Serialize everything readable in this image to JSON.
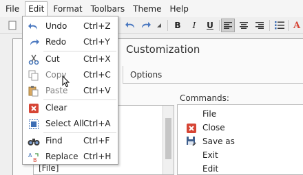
{
  "menubar": {
    "items": [
      {
        "label": "File"
      },
      {
        "label": "Edit"
      },
      {
        "label": "Format"
      },
      {
        "label": "Toolbars"
      },
      {
        "label": "Theme"
      },
      {
        "label": "Help"
      }
    ]
  },
  "toolbar": {
    "bold": "B",
    "italic": "I",
    "underline": "U",
    "font_color": "A"
  },
  "dialog": {
    "title": "Customization",
    "tab_options": "Options",
    "commands_label": "Commands:",
    "tree_item": "[File]",
    "commands": [
      {
        "label": "File",
        "icon": ""
      },
      {
        "label": "Close",
        "icon": "close-red-icon"
      },
      {
        "label": "Save as",
        "icon": "save-as-icon"
      },
      {
        "label": "Exit",
        "icon": ""
      },
      {
        "label": "Edit",
        "icon": ""
      }
    ]
  },
  "edit_menu": {
    "items": [
      {
        "label": "Undo",
        "shortcut": "Ctrl+Z",
        "icon": "undo-icon",
        "enabled": true
      },
      {
        "label": "Redo",
        "shortcut": "Ctrl+Y",
        "icon": "redo-icon",
        "enabled": true
      },
      {
        "label": "Cut",
        "shortcut": "Ctrl+X",
        "icon": "scissors-icon",
        "enabled": true
      },
      {
        "label": "Copy",
        "shortcut": "Ctrl+C",
        "icon": "copy-icon",
        "enabled": false
      },
      {
        "label": "Paste",
        "shortcut": "Ctrl+V",
        "icon": "paste-icon",
        "enabled": false
      },
      {
        "label": "Clear",
        "shortcut": "",
        "icon": "clear-icon",
        "enabled": true
      },
      {
        "label": "Select All",
        "shortcut": "Ctrl+A",
        "icon": "select-all-icon",
        "enabled": true
      },
      {
        "label": "Find",
        "shortcut": "Ctrl+F",
        "icon": "binoculars-icon",
        "enabled": true
      },
      {
        "label": "Replace",
        "shortcut": "Ctrl+H",
        "icon": "replace-icon",
        "enabled": true
      }
    ]
  },
  "colors": {
    "accent_blue": "#3e6fb5",
    "red": "#d64535"
  }
}
